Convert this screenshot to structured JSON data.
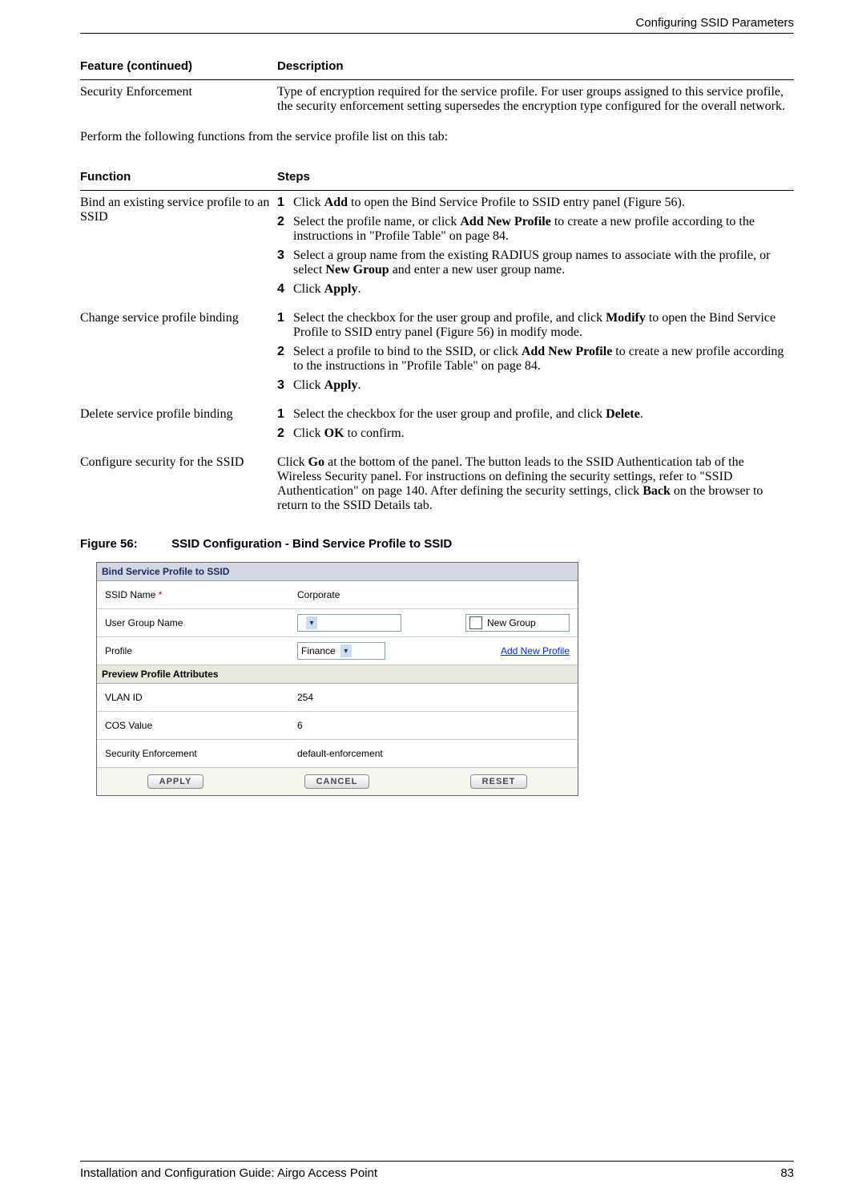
{
  "header": {
    "section": "Configuring SSID Parameters"
  },
  "table1": {
    "headers": [
      "Feature  (continued)",
      "Description"
    ],
    "rows": [
      {
        "feature": "Security Enforcement",
        "description": "Type of encryption required for the service profile. For user groups assigned to this service profile, the security enforcement setting supersedes the encryption type configured for the overall network."
      }
    ]
  },
  "intro": "Perform the following functions from the service profile list on this tab:",
  "table2": {
    "headers": [
      "Function",
      "Steps"
    ],
    "rows": [
      {
        "function": "Bind an existing service profile to an SSID",
        "steps": [
          {
            "n": "1",
            "parts": [
              "Click ",
              "Add",
              " to open the Bind Service Profile to SSID entry panel (Figure 56)."
            ]
          },
          {
            "n": "2",
            "parts": [
              "Select the profile name, or click ",
              "Add New Profile",
              " to create a new profile according to the instructions in \"Profile Table\" on page 84."
            ]
          },
          {
            "n": "3",
            "parts": [
              "Select a group name from the existing RADIUS group names to associate with the profile, or select ",
              "New Group",
              " and enter a new user group name."
            ]
          },
          {
            "n": "4",
            "parts": [
              "Click ",
              "Apply",
              "."
            ]
          }
        ]
      },
      {
        "function": "Change service profile binding",
        "steps": [
          {
            "n": "1",
            "parts": [
              "Select the checkbox for the user group and profile, and click ",
              "Modify",
              " to open the Bind Service Profile to SSID entry panel (Figure 56) in modify mode."
            ]
          },
          {
            "n": "2",
            "parts": [
              "Select a profile to bind to the SSID, or click ",
              "Add New Profile",
              " to create a new profile according to the instructions in \"Profile Table\" on page 84."
            ]
          },
          {
            "n": "3",
            "parts": [
              "Click ",
              "Apply",
              "."
            ]
          }
        ]
      },
      {
        "function": "Delete service profile binding",
        "steps": [
          {
            "n": "1",
            "parts": [
              "Select the checkbox for the user group and profile, and click ",
              "Delete",
              "."
            ]
          },
          {
            "n": "2",
            "parts": [
              "Click ",
              "OK",
              " to confirm."
            ]
          }
        ]
      },
      {
        "function": "Configure security for the SSID",
        "plain_parts": [
          "Click ",
          "Go",
          " at the bottom of the panel. The button leads to the SSID Authentication tab of the Wireless Security panel. For instructions on defining the security settings, refer to \"SSID Authentication\" on page 140. After defining the security settings, click ",
          "Back",
          " on the browser to return to the SSID Details tab."
        ]
      }
    ]
  },
  "figure": {
    "label": "Figure 56:",
    "title": "SSID Configuration - Bind Service Profile to SSID",
    "panel_title": "Bind Service Profile to SSID",
    "rows": {
      "ssid_name_label": "SSID Name",
      "ssid_required": "*",
      "ssid_value": "Corporate",
      "user_group_label": "User Group Name",
      "user_group_value": "",
      "new_group_label": "New Group",
      "profile_label": "Profile",
      "profile_value": "Finance",
      "add_new_profile": "Add New Profile"
    },
    "section2": "Preview Profile Attributes",
    "vlan_label": "VLAN ID",
    "vlan_value": "254",
    "cos_label": "COS Value",
    "cos_value": "6",
    "sec_label": "Security Enforcement",
    "sec_value": "default-enforcement",
    "buttons": {
      "apply": "APPLY",
      "cancel": "CANCEL",
      "reset": "RESET"
    }
  },
  "footer": {
    "left": "Installation and Configuration Guide: Airgo Access Point",
    "right": "83"
  }
}
